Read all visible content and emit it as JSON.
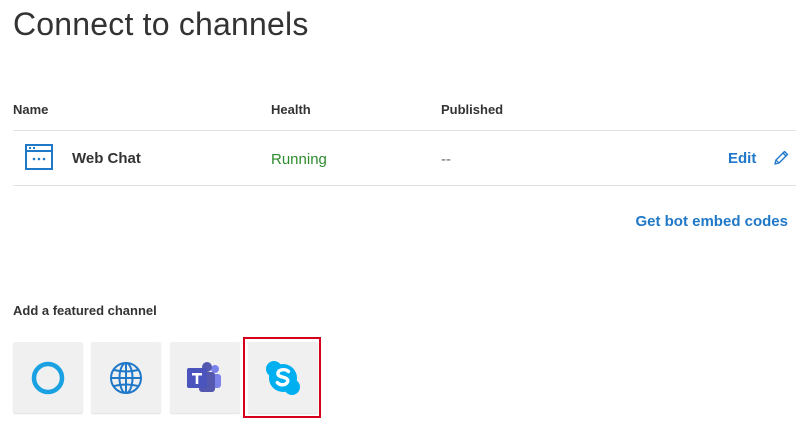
{
  "page": {
    "title": "Connect to channels"
  },
  "table": {
    "headers": {
      "name": "Name",
      "health": "Health",
      "published": "Published"
    },
    "rows": [
      {
        "icon": "web-chat-icon",
        "name": "Web Chat",
        "health": "Running",
        "published": "--",
        "edit_label": "Edit"
      }
    ]
  },
  "embed_link": "Get bot embed codes",
  "featured": {
    "label": "Add a featured channel",
    "channels": [
      {
        "icon": "cortana-icon"
      },
      {
        "icon": "web-globe-icon"
      },
      {
        "icon": "teams-icon"
      },
      {
        "icon": "skype-icon",
        "highlighted": true
      }
    ]
  },
  "colors": {
    "accent": "#1f78c8",
    "status_running": "#2e8b2e",
    "highlight": "#d6001c",
    "cortana": "#1ba1e2",
    "teams": "#5558af",
    "skype": "#00aff0"
  }
}
